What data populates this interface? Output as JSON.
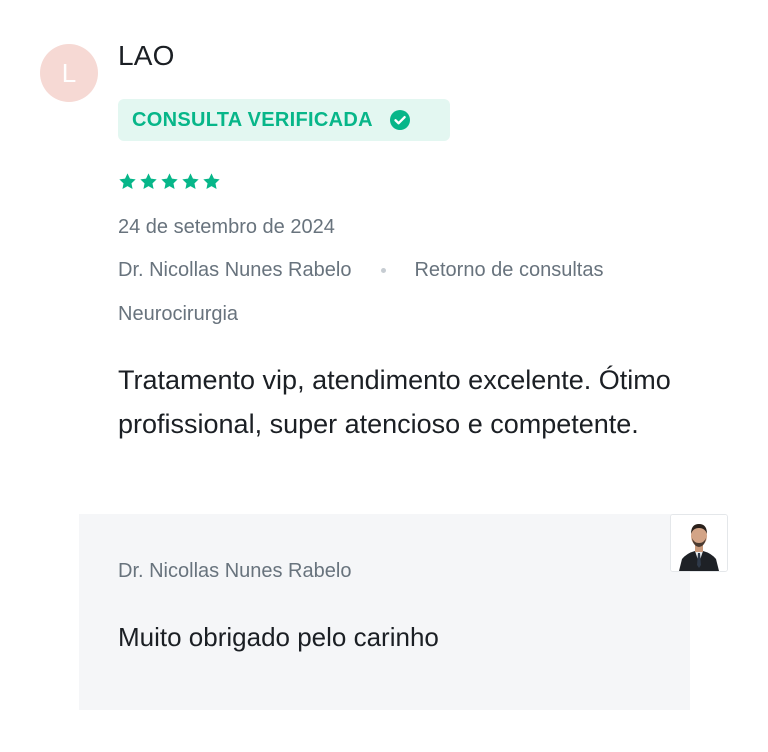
{
  "review": {
    "avatar_initial": "L",
    "author": "LAO",
    "badge": {
      "label": "CONSULTA VERIFICADA",
      "icon": "check-circle-icon",
      "color": "#07b689",
      "background": "#e3f7f1"
    },
    "rating": 5,
    "star_color": "#07b689",
    "date": "24 de setembro de 2024",
    "doctor": "Dr. Nicollas Nunes Rabelo",
    "service": "Retorno de consultas",
    "specialty": "Neurocirurgia",
    "text": "Tratamento vip, atendimento excelente. Ótimo profissional, super atencioso e competente."
  },
  "reply": {
    "author": "Dr. Nicollas Nunes Rabelo",
    "text": "Muito obrigado pelo carinho",
    "photo_icon": "doctor-avatar-icon"
  }
}
